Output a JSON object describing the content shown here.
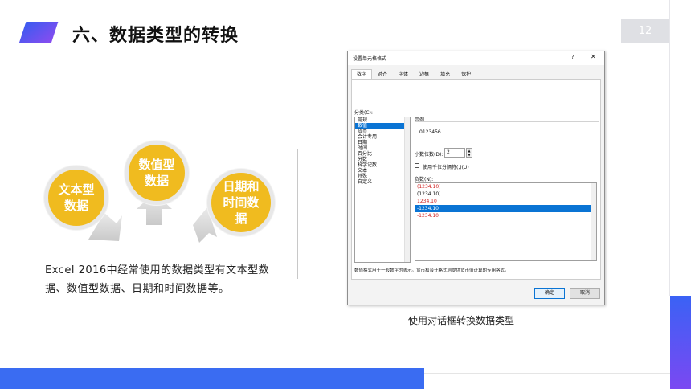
{
  "slide": {
    "title": "六、数据类型的转换",
    "page_number": "— 12 —",
    "circles": {
      "text": "文本型\n数据",
      "number": "数值型\n数据",
      "date": "日期和\n时间数\n据"
    },
    "description": "Excel 2016中经常使用的数据类型有文本型数据、数值型数据、日期和时间数据等。",
    "caption": "使用对话框转换数据类型",
    "colors": {
      "accent_blue": "#3a6cf2",
      "accent_purple": "#7b48f2",
      "circle_yellow": "#f0bb1f"
    }
  },
  "dialog": {
    "title": "设置单元格格式",
    "help": "?",
    "close": "✕",
    "tabs": [
      "数字",
      "对齐",
      "字体",
      "边框",
      "填充",
      "保护"
    ],
    "category_label": "分类(C):",
    "categories": [
      "常规",
      "数值",
      "货币",
      "会计专用",
      "日期",
      "时间",
      "百分比",
      "分数",
      "科学记数",
      "文本",
      "特殊",
      "自定义"
    ],
    "selected_category": "数值",
    "sample_label": "示例",
    "sample_value": "0123456",
    "decimal_label": "小数位数(D):",
    "decimal_value": "2",
    "thousands_label": "使用千位分隔符(,)(U)",
    "negative_label": "负数(N):",
    "negative_options": [
      "(1234.10)",
      "(1234.10)",
      "1234.10",
      "-1234.10",
      "-1234.10"
    ],
    "negative_colors": [
      "#d02020",
      "#222222",
      "#d02020",
      "#ffffff",
      "#d02020"
    ],
    "selected_negative_index": 3,
    "description": "数值格式用于一般数字的表示。货币和会计格式则提供货币值计算的专用格式。",
    "ok_label": "确定",
    "cancel_label": "取消"
  }
}
